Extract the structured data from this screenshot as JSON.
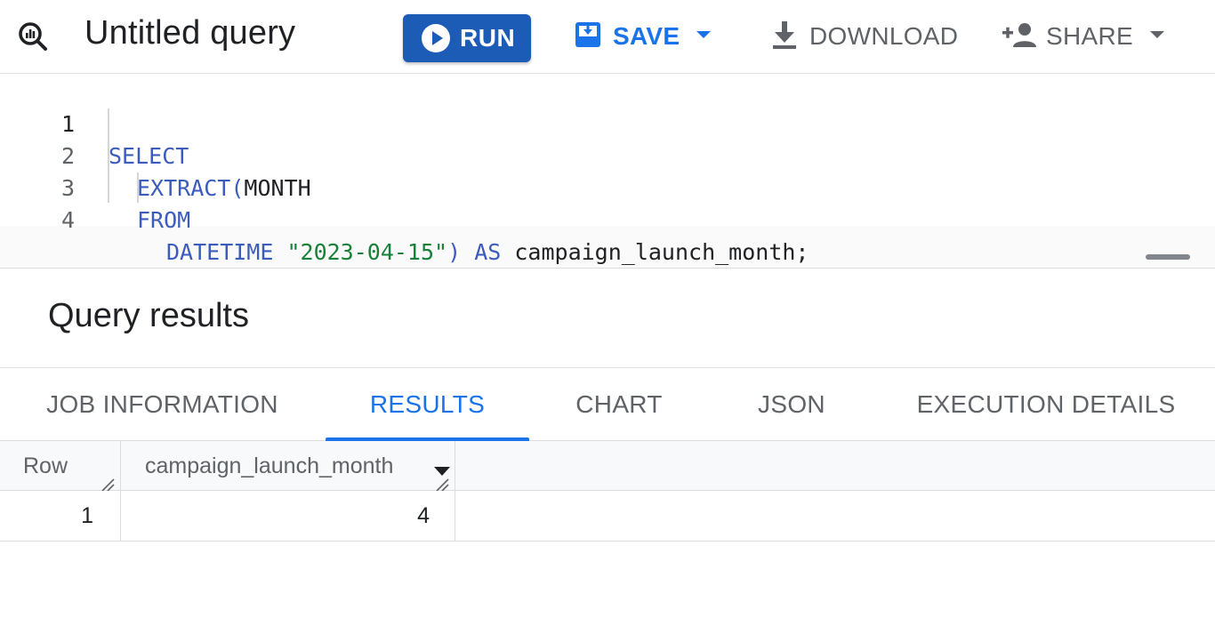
{
  "toolbar": {
    "title": "Untitled query",
    "run_label": "RUN",
    "save_label": "SAVE",
    "download_label": "DOWNLOAD",
    "share_label": "SHARE",
    "icons": {
      "query": "query-magnifier-icon",
      "run": "play-circle-icon",
      "save": "save-icon",
      "save_menu": "chevron-down-icon",
      "download": "download-icon",
      "share": "person-add-icon",
      "share_menu": "chevron-down-icon"
    }
  },
  "editor": {
    "lines": [
      {
        "num": "1",
        "tokens": [
          {
            "t": "SELECT",
            "k": "kw"
          }
        ]
      },
      {
        "num": "2",
        "tokens": [
          {
            "t": "EXTRACT(",
            "k": "kw"
          },
          {
            "t": "MONTH",
            "k": "id"
          }
        ]
      },
      {
        "num": "3",
        "tokens": [
          {
            "t": "FROM",
            "k": "kw"
          }
        ]
      },
      {
        "num": "4",
        "tokens": [
          {
            "t": "DATETIME ",
            "k": "kw"
          },
          {
            "t": "\"2023-04-15\"",
            "k": "str"
          },
          {
            "t": ") ",
            "k": "kw"
          },
          {
            "t": "AS ",
            "k": "kw"
          },
          {
            "t": "campaign_launch_month;",
            "k": "id"
          }
        ]
      }
    ]
  },
  "results": {
    "title": "Query results",
    "tabs": [
      {
        "label": "JOB INFORMATION",
        "active": false
      },
      {
        "label": "RESULTS",
        "active": true
      },
      {
        "label": "CHART",
        "active": false
      },
      {
        "label": "JSON",
        "active": false
      },
      {
        "label": "EXECUTION DETAILS",
        "active": false
      }
    ],
    "columns": [
      "Row",
      "campaign_launch_month"
    ],
    "rows": [
      {
        "row": "1",
        "value": "4"
      }
    ]
  },
  "colors": {
    "primary": "#1a73e8",
    "run_button": "#1c5bb6",
    "keyword": "#3b5bbd",
    "string": "#188038",
    "muted": "#5f6368"
  }
}
